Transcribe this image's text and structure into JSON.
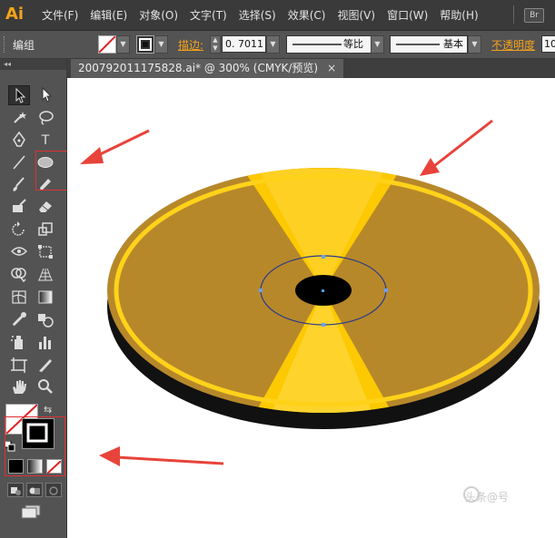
{
  "app": {
    "logo": "Ai",
    "menus": [
      "文件(F)",
      "编辑(E)",
      "对象(O)",
      "文字(T)",
      "选择(S)",
      "效果(C)",
      "视图(V)",
      "窗口(W)",
      "帮助(H)"
    ],
    "bridge_badge": "Br"
  },
  "control_bar": {
    "selection_label": "编组",
    "stroke_label": "描边:",
    "stroke_weight": "0. 7011",
    "dash_profile": "等比",
    "brush_profile": "基本",
    "opacity_label": "不透明度",
    "opacity_value": "10"
  },
  "document_tab": {
    "title": "200792011175828.ai* @ 300% (CMYK/预览)",
    "close": "×"
  },
  "tools_panel": {
    "header": "◂◂",
    "type_tool": "T"
  },
  "watermark": "头条@号",
  "colors": {
    "disc_gold": "#b7882a",
    "disc_bright": "#ffcc00",
    "rim": "#ffd21a",
    "annotation_arrow": "#e8433a",
    "ui_bg": "#535353"
  }
}
